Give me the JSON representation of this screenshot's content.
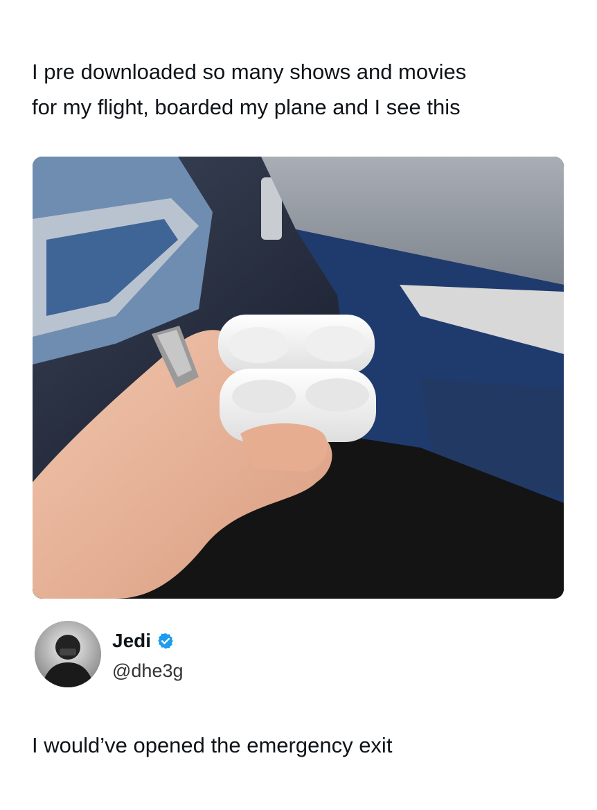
{
  "post": {
    "text": "I pre downloaded so many shows and movies\nfor my flight, boarded my plane and I see this",
    "photo_icon": "photo-airpods-case-on-plane"
  },
  "reply": {
    "display_name": "Jedi",
    "handle": "@dhe3g",
    "verified": true,
    "verified_color": "#1d9bf0",
    "text": "I would’ve opened the emergency exit"
  }
}
